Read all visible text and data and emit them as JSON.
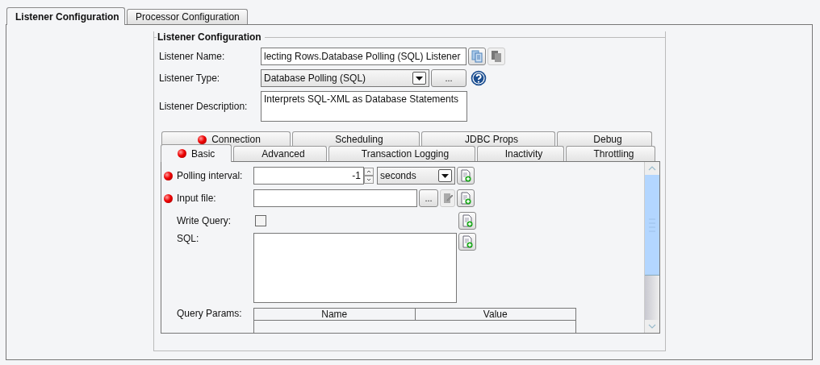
{
  "tabs": [
    {
      "label": "Listener Configuration",
      "selected": true
    },
    {
      "label": "Processor Configuration",
      "selected": false
    }
  ],
  "listener_configuration": {
    "title": "Listener Configuration",
    "name": {
      "label": "Listener Name:",
      "value": "lecting Rows.Database Polling (SQL) Listener"
    },
    "type": {
      "label": "Listener Type:",
      "value": "Database Polling (SQL)",
      "browse": "..."
    },
    "description": {
      "label": "Listener Description:",
      "value": "Interprets SQL-XML as Database Statements"
    }
  },
  "inner_tabs": [
    [
      {
        "label": "Connection",
        "flagged": true,
        "selected": false
      },
      {
        "label": "Scheduling",
        "flagged": false,
        "selected": false
      },
      {
        "label": "JDBC Props",
        "flagged": false,
        "selected": false
      },
      {
        "label": "Debug",
        "flagged": false,
        "selected": false
      }
    ],
    [
      {
        "label": "Basic",
        "flagged": true,
        "selected": true
      },
      {
        "label": "Advanced",
        "flagged": false,
        "selected": false
      },
      {
        "label": "Transaction Logging",
        "flagged": false,
        "selected": false
      },
      {
        "label": "Inactivity",
        "flagged": false,
        "selected": false
      },
      {
        "label": "Throttling",
        "flagged": false,
        "selected": false
      }
    ]
  ],
  "basic_form": [
    {
      "kind": "spinner",
      "label": "Polling interval:",
      "flagged": true,
      "value": "-1",
      "unit": "seconds"
    },
    {
      "kind": "file",
      "label": "Input file:",
      "flagged": true,
      "browse": "..."
    },
    {
      "kind": "checkbox",
      "label": "Write Query:",
      "flagged": false,
      "checked": false
    },
    {
      "kind": "textarea",
      "label": "SQL:",
      "flagged": false
    },
    {
      "kind": "table",
      "label": "Query Params:",
      "flagged": false,
      "columns": [
        "Name",
        "Value"
      ]
    }
  ]
}
